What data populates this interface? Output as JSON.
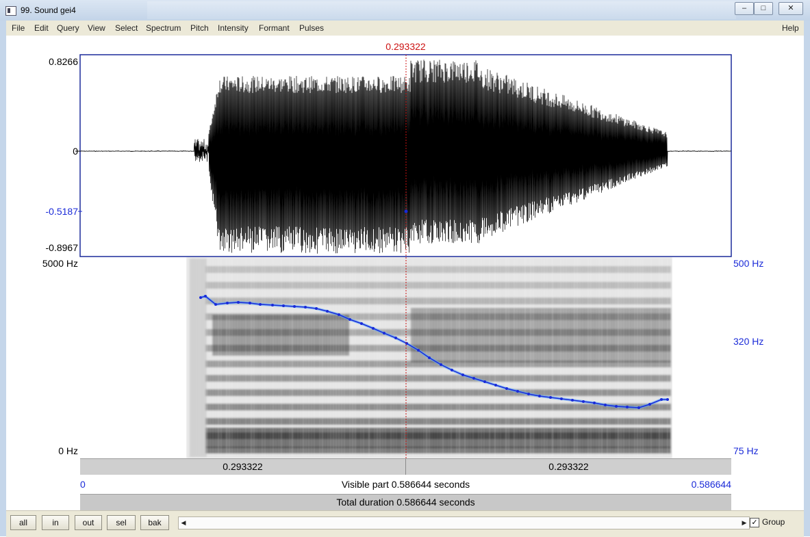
{
  "window": {
    "title": "99. Sound gei4"
  },
  "menu": {
    "items": [
      "File",
      "Edit",
      "Query",
      "View",
      "Select",
      "Spectrum",
      "Pitch",
      "Intensity",
      "Formant",
      "Pulses"
    ],
    "help": "Help"
  },
  "waveform": {
    "ymax": "0.8266",
    "zero": "0",
    "cursor_value": "-0.5187",
    "ymin": "-0.8967"
  },
  "spectrogram": {
    "top_freq": "5000 Hz",
    "bottom_freq": "0 Hz",
    "pitch_top": "500 Hz",
    "pitch_mid": "320 Hz",
    "pitch_bottom": "75 Hz"
  },
  "cursor": {
    "time": "0.293322"
  },
  "time_rows": {
    "left_segment": "0.293322",
    "right_segment": "0.293322",
    "start": "0",
    "visible_label": "Visible part 0.586644 seconds",
    "end": "0.586644",
    "total_label": "Total duration 0.586644 seconds"
  },
  "buttons": {
    "all": "all",
    "in": "in",
    "out": "out",
    "sel": "sel",
    "bak": "bak"
  },
  "group": {
    "label": "Group",
    "checked": true
  },
  "colors": {
    "cursor": "#cc1111",
    "pitch": "#1a2ad8",
    "pitch_line": "#2a7ae6"
  }
}
